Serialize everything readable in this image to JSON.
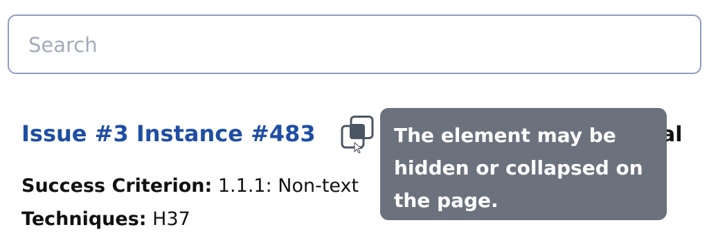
{
  "search": {
    "placeholder": "Search",
    "value": ""
  },
  "issue": {
    "title": "Issue #3 Instance #483",
    "copy_icon": "copy-icon",
    "trailing_fragment": "al",
    "success_criterion_label": "Success Criterion:",
    "success_criterion_value": "1.1.1: Non-text",
    "techniques_label": "Techniques:",
    "techniques_value": "H37"
  },
  "tooltip": {
    "text": "The element may be hidden or collapsed on the page."
  },
  "colors": {
    "title_link": "#1f4ea3",
    "search_border": "#8d9bbd",
    "placeholder": "#a3abbb",
    "tooltip_bg": "#6c727d",
    "icon": "#4b5563"
  }
}
